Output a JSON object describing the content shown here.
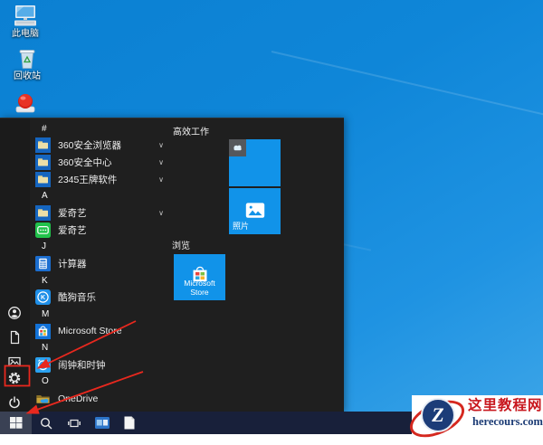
{
  "desktop": {
    "icons": [
      {
        "name": "this-pc",
        "label": "此电脑"
      },
      {
        "name": "recycle-bin",
        "label": "回收站"
      },
      {
        "name": "red-button-app",
        "label": ""
      }
    ]
  },
  "start_menu": {
    "chevron_glyph": "∨",
    "app_list": [
      {
        "type": "section",
        "label": "#"
      },
      {
        "type": "app",
        "label": "360安全浏览器",
        "icon": "folder",
        "expandable": true
      },
      {
        "type": "app",
        "label": "360安全中心",
        "icon": "folder",
        "expandable": true
      },
      {
        "type": "app",
        "label": "2345王牌软件",
        "icon": "folder",
        "expandable": true
      },
      {
        "type": "section",
        "label": "A"
      },
      {
        "type": "app",
        "label": "爱奇艺",
        "icon": "folder",
        "expandable": true
      },
      {
        "type": "app",
        "label": "爱奇艺",
        "icon": "iqiyi"
      },
      {
        "type": "section",
        "label": "J"
      },
      {
        "type": "app",
        "label": "计算器",
        "icon": "calculator"
      },
      {
        "type": "section",
        "label": "K"
      },
      {
        "type": "app",
        "label": "酷狗音乐",
        "icon": "kugou"
      },
      {
        "type": "section",
        "label": "M"
      },
      {
        "type": "app",
        "label": "Microsoft Store",
        "icon": "store"
      },
      {
        "type": "section",
        "label": "N"
      },
      {
        "type": "app",
        "label": "闹钟和时钟",
        "icon": "clock"
      },
      {
        "type": "section",
        "label": "O"
      },
      {
        "type": "app",
        "label": "OneDrive",
        "icon": "onedrive"
      }
    ],
    "tiles": {
      "group1_header": "高效工作",
      "group2_header": "浏览",
      "group1": [
        {
          "icon": "cloud-badge",
          "label": ""
        },
        {
          "icon": "photos",
          "label": "照片"
        }
      ],
      "group2": [
        {
          "icon": "store",
          "label": "Microsoft Store"
        }
      ]
    },
    "rail_items": [
      "account",
      "documents",
      "pictures",
      "settings",
      "power"
    ]
  },
  "taskbar": {
    "buttons": [
      "start",
      "search",
      "task-view",
      "photos-app",
      "notepad-app"
    ]
  },
  "watermark": {
    "site_name": "这里教程网",
    "site_domain": "herecours.com",
    "logo_letter": "Z"
  },
  "colors": {
    "annotation_red": "#e8281e",
    "tile_blue": "#1193e9",
    "watermark_red": "#c8161d",
    "watermark_navy": "#1a3a74",
    "taskbar_navy": "#18203a"
  }
}
